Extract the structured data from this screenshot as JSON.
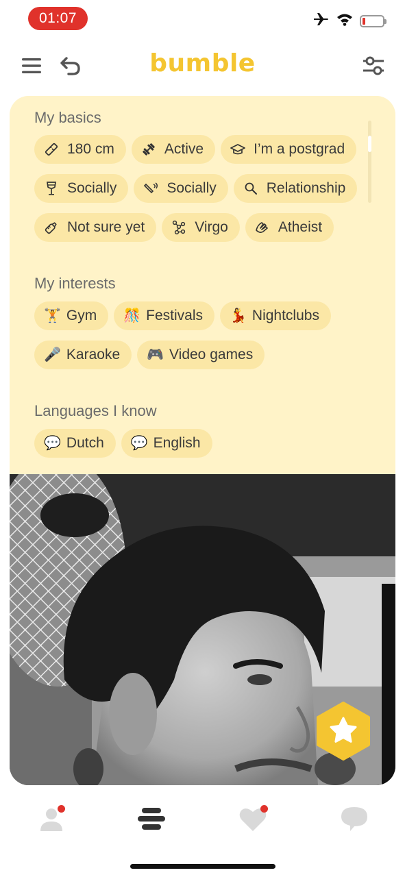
{
  "status_bar": {
    "time": "01:07",
    "icons": [
      "airplane-icon",
      "wifi-icon",
      "battery-icon"
    ],
    "battery_level": 0.08,
    "time_pill_color": "#e0322b"
  },
  "header": {
    "logo": "bumble",
    "logo_color": "#f4c531",
    "left_icons": [
      "menu-icon",
      "undo-icon"
    ],
    "right_icon": "filter-icon"
  },
  "profile": {
    "basics_title": "My basics",
    "basics": [
      {
        "icon": "ruler-icon",
        "label": "180 cm"
      },
      {
        "icon": "dumbbell-icon",
        "label": "Active"
      },
      {
        "icon": "graduation-cap-icon",
        "label": "I’m a postgrad"
      },
      {
        "icon": "wine-glass-icon",
        "label": "Socially"
      },
      {
        "icon": "smoking-icon",
        "label": "Socially"
      },
      {
        "icon": "search-icon",
        "label": "Relationship"
      },
      {
        "icon": "baby-bottle-icon",
        "label": "Not sure yet"
      },
      {
        "icon": "zodiac-icon",
        "label": "Virgo"
      },
      {
        "icon": "praying-hands-icon",
        "label": "Atheist"
      }
    ],
    "interests_title": "My interests",
    "interests": [
      {
        "emoji": "🏋️",
        "label": "Gym"
      },
      {
        "emoji": "🎊",
        "label": "Festivals"
      },
      {
        "emoji": "💃",
        "label": "Nightclubs"
      },
      {
        "emoji": "🎤",
        "label": "Karaoke"
      },
      {
        "emoji": "🎮",
        "label": "Video games"
      }
    ],
    "languages_title": "Languages I know",
    "languages": [
      {
        "emoji": "💬",
        "label": "Dutch"
      },
      {
        "emoji": "💬",
        "label": "English"
      }
    ],
    "card_bg": "#fff3c8",
    "chip_bg": "#fbe7a6"
  },
  "photo": {
    "content": "profile-photo",
    "superswipe_icon": "star-icon",
    "superswipe_color": "#f4c531"
  },
  "bottom_nav": {
    "items": [
      {
        "icon": "profile-icon",
        "notification": true
      },
      {
        "icon": "discover-icon",
        "notification": false,
        "active": true
      },
      {
        "icon": "likes-heart-icon",
        "notification": true
      },
      {
        "icon": "chat-bubble-icon",
        "notification": false
      }
    ]
  }
}
